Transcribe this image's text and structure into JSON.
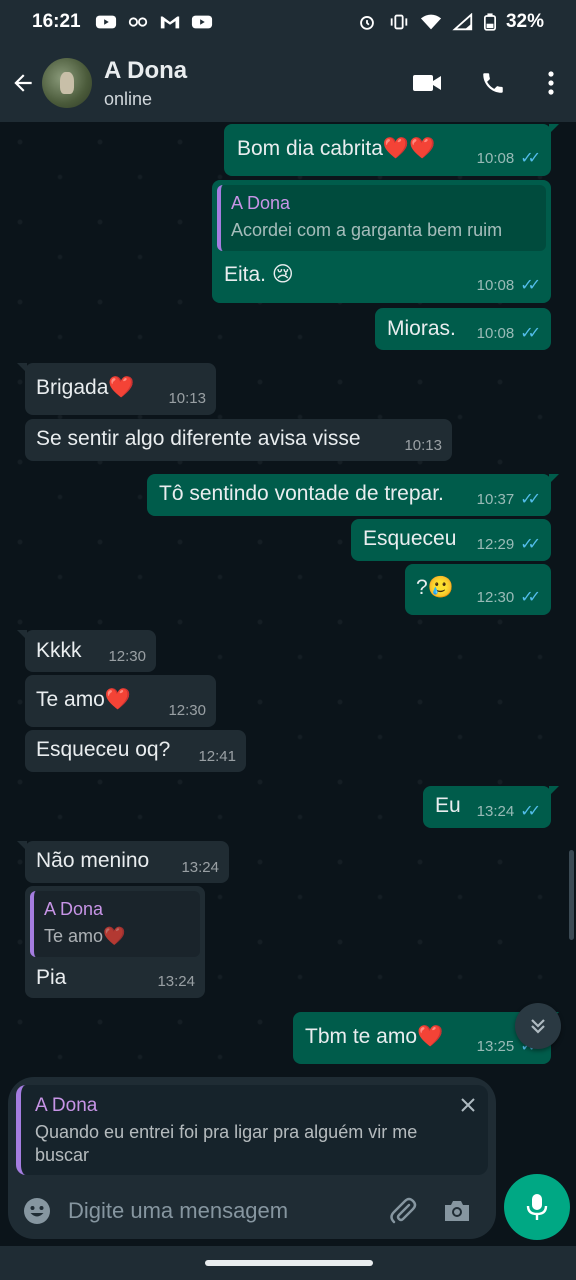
{
  "status_bar": {
    "time": "16:21",
    "battery": "32%",
    "left_icons": [
      "youtube-icon",
      "link-icon",
      "gmail-icon",
      "youtube-icon"
    ],
    "right_icons": [
      "alarm-icon",
      "vibrate-icon",
      "wifi-icon",
      "signal-icon",
      "battery-icon"
    ]
  },
  "header": {
    "contact_name": "A Dona",
    "status": "online"
  },
  "messages": [
    {
      "dir": "out",
      "text": "Bom dia cabrita❤️❤️",
      "time": "10:08"
    },
    {
      "dir": "out",
      "quote_name": "A Dona",
      "quote_text": "Acordei com a garganta bem ruim",
      "text": "Eita. 😢",
      "time": "10:08"
    },
    {
      "dir": "out",
      "text": "Mioras.",
      "time": "10:08"
    },
    {
      "dir": "in",
      "text": "Brigada❤️",
      "time": "10:13"
    },
    {
      "dir": "in",
      "text": "Se sentir algo diferente avisa visse",
      "time": "10:13"
    },
    {
      "dir": "out",
      "text": "Tô sentindo vontade de trepar.",
      "time": "10:37"
    },
    {
      "dir": "out",
      "text": "Esqueceu",
      "time": "12:29"
    },
    {
      "dir": "out",
      "text": "?🥲",
      "time": "12:30"
    },
    {
      "dir": "in",
      "text": "Kkkk",
      "time": "12:30"
    },
    {
      "dir": "in",
      "text": "Te amo❤️",
      "time": "12:30"
    },
    {
      "dir": "in",
      "text": "Esqueceu oq?",
      "time": "12:41"
    },
    {
      "dir": "out",
      "text": "Eu",
      "time": "13:24"
    },
    {
      "dir": "in",
      "text": "Não menino",
      "time": "13:24"
    },
    {
      "dir": "in",
      "quote_name": "A Dona",
      "quote_text": "Te amo❤️",
      "text": "Pia",
      "time": "13:24"
    },
    {
      "dir": "out",
      "text": "Tbm te amo❤️",
      "time": "13:25"
    }
  ],
  "reply": {
    "name": "A Dona",
    "text": "Quando eu entrei foi pra ligar pra alguém vir me buscar"
  },
  "composer": {
    "placeholder": "Digite uma mensagem"
  },
  "colors": {
    "outgoing_bubble": "#005c4b",
    "incoming_bubble": "#202c33",
    "accent": "#00a884",
    "read_ticks": "#53bdeb",
    "quote_name": "#c794e6"
  }
}
